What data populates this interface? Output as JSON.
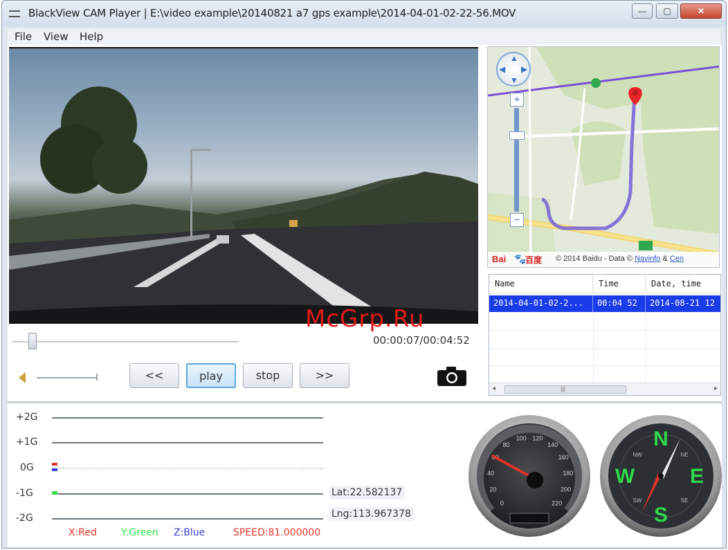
{
  "window": {
    "title": "BlackView CAM Player | E:\\video example\\20140821 a7 gps example\\2014-04-01-02-22-56.MOV",
    "controls": {
      "minimize": "—",
      "maximize": "▢",
      "close": "✕"
    }
  },
  "menu": {
    "items": [
      "File",
      "View",
      "Help"
    ]
  },
  "player": {
    "time": "00:00:07/00:04:52",
    "seek_fraction": 0.024,
    "buttons": {
      "rewind": "<<",
      "play": "play",
      "stop": "stop",
      "forward": ">>"
    }
  },
  "map": {
    "logo": "Bai",
    "logo_cn": "百度",
    "copyright": "© 2014 Baidu - Data ©",
    "link1": "Navinfo",
    "amp": "&",
    "link2": "Cen",
    "nav_arrows": {
      "up": "▲",
      "down": "▼",
      "left": "◀",
      "right": "▶"
    },
    "zoom_in": "+",
    "zoom_out": "−"
  },
  "file_list": {
    "columns": [
      "Name",
      "Time",
      "Date, time"
    ],
    "rows": [
      {
        "name": "2014-04-01-02-2...",
        "time": "00:04 52",
        "datetime": "2014-08-21 12"
      }
    ],
    "scroll_left": "◂",
    "scroll_right": "▸",
    "scroll_grip": "|||"
  },
  "gsensor": {
    "labels": [
      "+2G",
      "+1G",
      "0G",
      "-1G",
      "-2G"
    ],
    "legend": {
      "x": "X:Red",
      "y": "Y:Green",
      "z": "Z:Blue",
      "speed": "SPEED:81.000000"
    }
  },
  "gps": {
    "lat": "Lat:22.582137",
    "lng": "Lng:113.967378"
  },
  "speedometer": {
    "ticks": [
      "0",
      "20",
      "40",
      "60",
      "80",
      "100",
      "120",
      "140",
      "160",
      "180",
      "200",
      "220"
    ],
    "value": 60
  },
  "compass": {
    "n": "N",
    "s": "S",
    "e": "E",
    "w": "W",
    "nw": "NW",
    "ne": "NE",
    "sw": "SW",
    "se": "SE"
  },
  "watermark": "McGrp.Ru",
  "colors": {
    "selected_row": "#1a3be8",
    "x_red": "#e0332b",
    "y_green": "#33e04a",
    "z_blue": "#3a42d6",
    "speed_red": "#e0332b",
    "watermark": "#e01b1b"
  }
}
